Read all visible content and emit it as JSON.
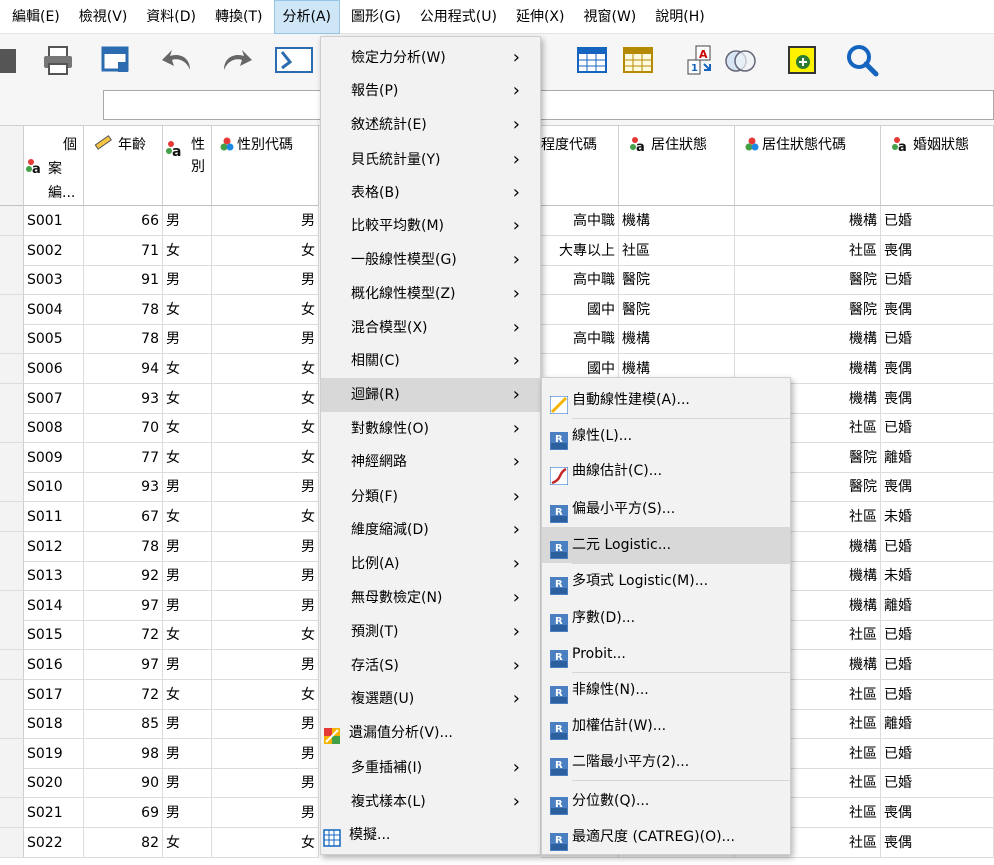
{
  "menubar": [
    "編輯(E)",
    "檢視(V)",
    "資料(D)",
    "轉換(T)",
    "分析(A)",
    "圖形(G)",
    "公用程式(U)",
    "延伸(X)",
    "視窗(W)",
    "說明(H)"
  ],
  "headers": {
    "case_id": [
      "個",
      "案",
      "編..."
    ],
    "age": "年齡",
    "sex": [
      "性",
      "別"
    ],
    "sex_code": "性別代碼",
    "edu_code": "程度代碼",
    "residence": "居住狀態",
    "residence_code": "居住狀態代碼",
    "marital": "婚姻狀態"
  },
  "rows": [
    {
      "id": "S001",
      "age": "66",
      "sex": "男",
      "sexc": "男",
      "edu": "高中職",
      "res": "機構",
      "resc": "機構",
      "mar": "已婚"
    },
    {
      "id": "S002",
      "age": "71",
      "sex": "女",
      "sexc": "女",
      "edu": "大專以上",
      "res": "社區",
      "resc": "社區",
      "mar": "喪偶"
    },
    {
      "id": "S003",
      "age": "91",
      "sex": "男",
      "sexc": "男",
      "edu": "高中職",
      "res": "醫院",
      "resc": "醫院",
      "mar": "已婚"
    },
    {
      "id": "S004",
      "age": "78",
      "sex": "女",
      "sexc": "女",
      "edu": "國中",
      "res": "醫院",
      "resc": "醫院",
      "mar": "喪偶"
    },
    {
      "id": "S005",
      "age": "78",
      "sex": "男",
      "sexc": "男",
      "edu": "高中職",
      "res": "機構",
      "resc": "機構",
      "mar": "已婚"
    },
    {
      "id": "S006",
      "age": "94",
      "sex": "女",
      "sexc": "女",
      "edu": "國中",
      "res": "機構",
      "resc": "機構",
      "mar": "喪偶"
    },
    {
      "id": "S007",
      "age": "93",
      "sex": "女",
      "sexc": "女",
      "edu": "",
      "res": "",
      "resc": "機構",
      "mar": "喪偶"
    },
    {
      "id": "S008",
      "age": "70",
      "sex": "女",
      "sexc": "女",
      "edu": "",
      "res": "",
      "resc": "社區",
      "mar": "已婚"
    },
    {
      "id": "S009",
      "age": "77",
      "sex": "女",
      "sexc": "女",
      "edu": "",
      "res": "",
      "resc": "醫院",
      "mar": "離婚"
    },
    {
      "id": "S010",
      "age": "93",
      "sex": "男",
      "sexc": "男",
      "edu": "",
      "res": "",
      "resc": "醫院",
      "mar": "喪偶"
    },
    {
      "id": "S011",
      "age": "67",
      "sex": "女",
      "sexc": "女",
      "edu": "",
      "res": "",
      "resc": "社區",
      "mar": "未婚"
    },
    {
      "id": "S012",
      "age": "78",
      "sex": "男",
      "sexc": "男",
      "edu": "",
      "res": "",
      "resc": "機構",
      "mar": "已婚"
    },
    {
      "id": "S013",
      "age": "92",
      "sex": "男",
      "sexc": "男",
      "edu": "",
      "res": "",
      "resc": "機構",
      "mar": "未婚"
    },
    {
      "id": "S014",
      "age": "97",
      "sex": "男",
      "sexc": "男",
      "edu": "",
      "res": "",
      "resc": "機構",
      "mar": "離婚"
    },
    {
      "id": "S015",
      "age": "72",
      "sex": "女",
      "sexc": "女",
      "edu": "",
      "res": "",
      "resc": "社區",
      "mar": "已婚"
    },
    {
      "id": "S016",
      "age": "97",
      "sex": "男",
      "sexc": "男",
      "edu": "",
      "res": "",
      "resc": "機構",
      "mar": "已婚"
    },
    {
      "id": "S017",
      "age": "72",
      "sex": "女",
      "sexc": "女",
      "edu": "",
      "res": "",
      "resc": "社區",
      "mar": "已婚"
    },
    {
      "id": "S018",
      "age": "85",
      "sex": "男",
      "sexc": "男",
      "edu": "",
      "res": "",
      "resc": "社區",
      "mar": "離婚"
    },
    {
      "id": "S019",
      "age": "98",
      "sex": "男",
      "sexc": "男",
      "edu": "",
      "res": "",
      "resc": "社區",
      "mar": "已婚"
    },
    {
      "id": "S020",
      "age": "90",
      "sex": "男",
      "sexc": "男",
      "edu": "",
      "res": "",
      "resc": "社區",
      "mar": "已婚"
    },
    {
      "id": "S021",
      "age": "69",
      "sex": "男",
      "sexc": "男",
      "edu": "",
      "res": "",
      "resc": "社區",
      "mar": "喪偶"
    },
    {
      "id": "S022",
      "age": "82",
      "sex": "女",
      "sexc": "女",
      "edu": "",
      "res": "",
      "resc": "社區",
      "mar": "喪偶"
    }
  ],
  "analyze_menu": [
    {
      "label": "檢定力分析(W)",
      "arrow": true
    },
    {
      "label": "報告(P)",
      "arrow": true
    },
    {
      "label": "敘述統計(E)",
      "arrow": true
    },
    {
      "label": "貝氏統計量(Y)",
      "arrow": true
    },
    {
      "label": "表格(B)",
      "arrow": true
    },
    {
      "label": "比較平均數(M)",
      "arrow": true
    },
    {
      "label": "一般線性模型(G)",
      "arrow": true
    },
    {
      "label": "概化線性模型(Z)",
      "arrow": true
    },
    {
      "label": "混合模型(X)",
      "arrow": true
    },
    {
      "label": "相關(C)",
      "arrow": true
    },
    {
      "label": "迴歸(R)",
      "arrow": true,
      "highlight": true
    },
    {
      "label": "對數線性(O)",
      "arrow": true
    },
    {
      "label": "神經網路",
      "arrow": true
    },
    {
      "label": "分類(F)",
      "arrow": true
    },
    {
      "label": "維度縮減(D)",
      "arrow": true
    },
    {
      "label": "比例(A)",
      "arrow": true
    },
    {
      "label": "無母數檢定(N)",
      "arrow": true
    },
    {
      "label": "預測(T)",
      "arrow": true
    },
    {
      "label": "存活(S)",
      "arrow": true
    },
    {
      "label": "複選題(U)",
      "arrow": true
    },
    {
      "label": "遺漏值分析(V)...",
      "arrow": false,
      "icon": "missing-values-icon"
    },
    {
      "label": "多重插補(I)",
      "arrow": true
    },
    {
      "label": "複式樣本(L)",
      "arrow": true
    },
    {
      "label": "模擬...",
      "arrow": false,
      "icon": "simulation-icon"
    }
  ],
  "regression_submenu": [
    {
      "label": "自動線性建模(A)...",
      "icon": "auto-linear-icon",
      "tag": ""
    },
    {
      "label": "線性(L)...",
      "icon": "linear-regression-icon",
      "tag": "LIN"
    },
    {
      "label": "曲線估計(C)...",
      "icon": "curve-estimation-icon",
      "tag": ""
    },
    {
      "label": "偏最小平方(S)...",
      "icon": "pls-icon",
      "tag": "PLS"
    },
    {
      "label": "二元 Logistic...",
      "icon": "binary-logistic-icon",
      "tag": "LOG",
      "highlight": true
    },
    {
      "label": "多項式 Logistic(M)...",
      "icon": "multinomial-logistic-icon",
      "tag": "MULT"
    },
    {
      "label": "序數(D)...",
      "icon": "ordinal-icon",
      "tag": "ORD"
    },
    {
      "label": "Probit...",
      "icon": "probit-icon",
      "tag": "PROB"
    },
    {
      "label": "非線性(N)...",
      "icon": "nonlinear-icon",
      "tag": "NLR"
    },
    {
      "label": "加權估計(W)...",
      "icon": "weight-estimation-icon",
      "tag": "WLS"
    },
    {
      "label": "二階最小平方(2)...",
      "icon": "two-stage-ls-icon",
      "tag": "2SLS"
    },
    {
      "label": "分位數(Q)...",
      "icon": "quantile-icon",
      "tag": "QUAN"
    },
    {
      "label": "最適尺度 (CATREG)(O)...",
      "icon": "catreg-icon",
      "tag": "CAT"
    }
  ]
}
